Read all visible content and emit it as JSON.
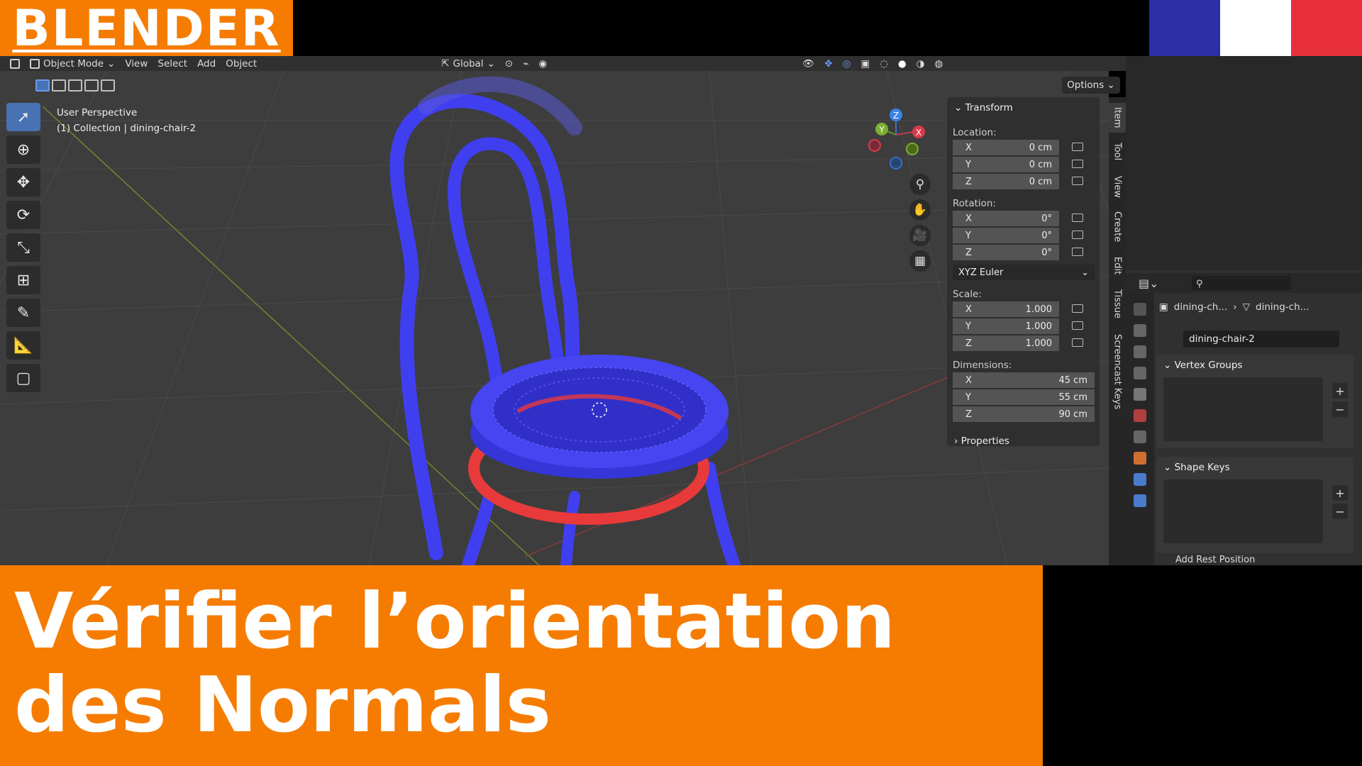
{
  "brand": {
    "label": "BLENDER",
    "color": "#f57c00"
  },
  "flag": {
    "colors": [
      "#2a2fa6",
      "#ffffff",
      "#e8303a"
    ]
  },
  "menubar": {
    "mode": "Object Mode",
    "menus": [
      "View",
      "Select",
      "Add",
      "Object"
    ],
    "orientation": "Global"
  },
  "viewport": {
    "perspective": "User Perspective",
    "collection": "(1) Collection | dining-chair-2",
    "options_label": "Options"
  },
  "npanel": {
    "transform_title": "Transform",
    "location_label": "Location:",
    "location": [
      {
        "axis": "X",
        "value": "0 cm"
      },
      {
        "axis": "Y",
        "value": "0 cm"
      },
      {
        "axis": "Z",
        "value": "0 cm"
      }
    ],
    "rotation_label": "Rotation:",
    "rotation": [
      {
        "axis": "X",
        "value": "0°"
      },
      {
        "axis": "Y",
        "value": "0°"
      },
      {
        "axis": "Z",
        "value": "0°"
      }
    ],
    "rotation_mode": "XYZ Euler",
    "scale_label": "Scale:",
    "scale": [
      {
        "axis": "X",
        "value": "1.000"
      },
      {
        "axis": "Y",
        "value": "1.000"
      },
      {
        "axis": "Z",
        "value": "1.000"
      }
    ],
    "dimensions_label": "Dimensions:",
    "dimensions": [
      {
        "axis": "X",
        "value": "45 cm"
      },
      {
        "axis": "Y",
        "value": "55 cm"
      },
      {
        "axis": "Z",
        "value": "90 cm"
      }
    ],
    "properties_title": "Properties"
  },
  "tabs": [
    "Item",
    "Tool",
    "View",
    "Create",
    "Edit",
    "Tissue",
    "Screencast Keys"
  ],
  "gizmo": {
    "x": "X",
    "y": "Y",
    "z": "Z"
  },
  "properties": {
    "breadcrumb_object": "dining-ch...",
    "breadcrumb_mesh": "dining-ch...",
    "mesh_name": "dining-chair-2",
    "vertex_groups": "Vertex Groups",
    "shape_keys": "Shape Keys",
    "add_rest_position": "Add Rest Position",
    "plus": "+",
    "minus": "−"
  },
  "banner": {
    "line1": "Vérifier l’orientation",
    "line2": "des Normals",
    "color": "#f57c00"
  },
  "colors": {
    "face_front": "#3f3ff0",
    "face_back": "#e83a3a",
    "active_tool": "#4772b3"
  }
}
